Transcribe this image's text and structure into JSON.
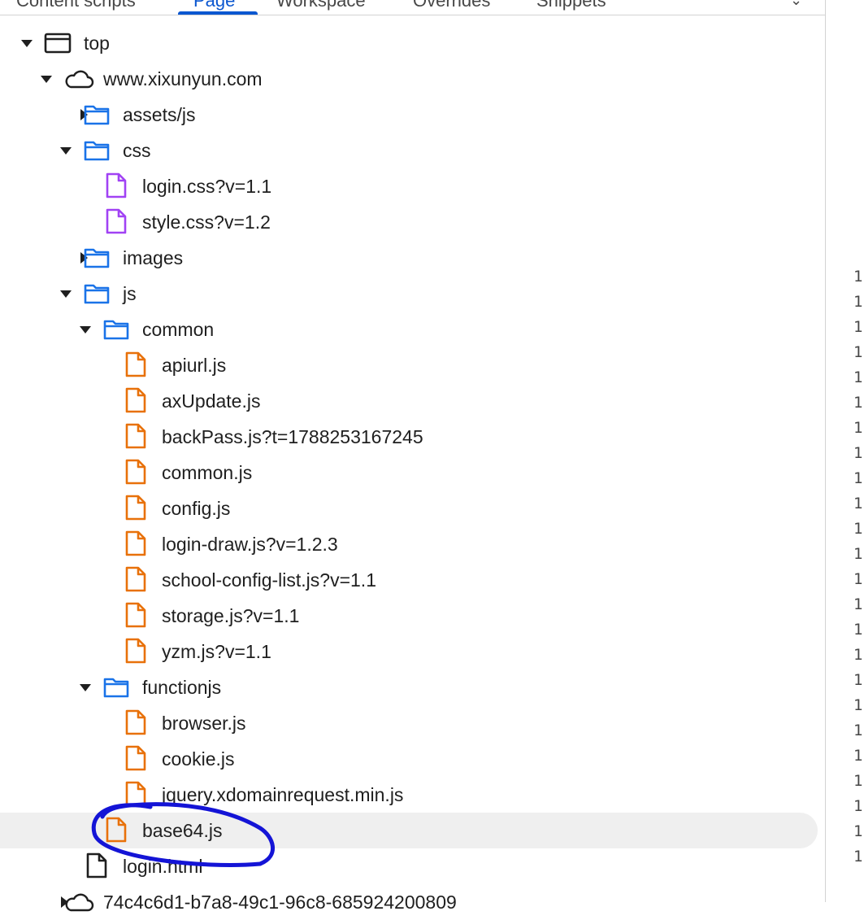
{
  "tabs": [
    {
      "label": "Content scripts",
      "active": false
    },
    {
      "label": "Page",
      "active": true
    },
    {
      "label": "Workspace",
      "active": false
    },
    {
      "label": "Overrides",
      "active": false
    },
    {
      "label": "Snippets",
      "active": false
    }
  ],
  "tree": [
    {
      "label": "top",
      "icon": "frame-icon",
      "expanded": true,
      "depth": 0
    },
    {
      "label": "www.xixunyun.com",
      "icon": "cloud-icon",
      "expanded": true,
      "depth": 1
    },
    {
      "label": "assets/js",
      "icon": "folder-icon",
      "expanded": false,
      "depth": 2
    },
    {
      "label": "css",
      "icon": "folder-icon",
      "expanded": true,
      "depth": 2
    },
    {
      "label": "login.css?v=1.1",
      "icon": "css-file-icon",
      "depth": 3
    },
    {
      "label": "style.css?v=1.2",
      "icon": "css-file-icon",
      "depth": 3
    },
    {
      "label": "images",
      "icon": "folder-icon",
      "expanded": false,
      "depth": 2
    },
    {
      "label": "js",
      "icon": "folder-icon",
      "expanded": true,
      "depth": 2
    },
    {
      "label": "common",
      "icon": "folder-icon",
      "expanded": true,
      "depth": 3
    },
    {
      "label": "apiurl.js",
      "icon": "js-file-icon",
      "depth": 4
    },
    {
      "label": "axUpdate.js",
      "icon": "js-file-icon",
      "depth": 4
    },
    {
      "label": "backPass.js?t=1788253167245",
      "icon": "js-file-icon",
      "depth": 4
    },
    {
      "label": "common.js",
      "icon": "js-file-icon",
      "depth": 4
    },
    {
      "label": "config.js",
      "icon": "js-file-icon",
      "depth": 4
    },
    {
      "label": "login-draw.js?v=1.2.3",
      "icon": "js-file-icon",
      "depth": 4
    },
    {
      "label": "school-config-list.js?v=1.1",
      "icon": "js-file-icon",
      "depth": 4
    },
    {
      "label": "storage.js?v=1.1",
      "icon": "js-file-icon",
      "depth": 4
    },
    {
      "label": "yzm.js?v=1.1",
      "icon": "js-file-icon",
      "depth": 4
    },
    {
      "label": "functionjs",
      "icon": "folder-icon",
      "expanded": true,
      "depth": 3
    },
    {
      "label": "browser.js",
      "icon": "js-file-icon",
      "depth": 4
    },
    {
      "label": "cookie.js",
      "icon": "js-file-icon",
      "depth": 4
    },
    {
      "label": "jquery.xdomainrequest.min.js",
      "icon": "js-file-icon",
      "depth": 4
    },
    {
      "label": "base64.js",
      "icon": "js-file-icon",
      "depth": 3,
      "selected": true
    },
    {
      "label": "login.html",
      "icon": "document-file-icon",
      "depth": 2
    },
    {
      "label": "74c4c6d1-b7a8-49c1-96c8-685924200809",
      "icon": "cloud-icon",
      "expanded": false,
      "depth": 1
    }
  ],
  "gutter_digits": [
    "1",
    "1",
    "1",
    "1",
    "1",
    "1",
    "1",
    "1",
    "1",
    "1",
    "1",
    "1",
    "1",
    "1",
    "1",
    "1",
    "1",
    "1",
    "1",
    "1",
    "1",
    "1",
    "1",
    "1"
  ],
  "colors": {
    "folder": "#1a73e8",
    "css_file": "#a142f4",
    "js_file": "#e8710a",
    "text": "#1f1f1f",
    "accent": "#0b57d0",
    "annotation": "#1414d6"
  }
}
